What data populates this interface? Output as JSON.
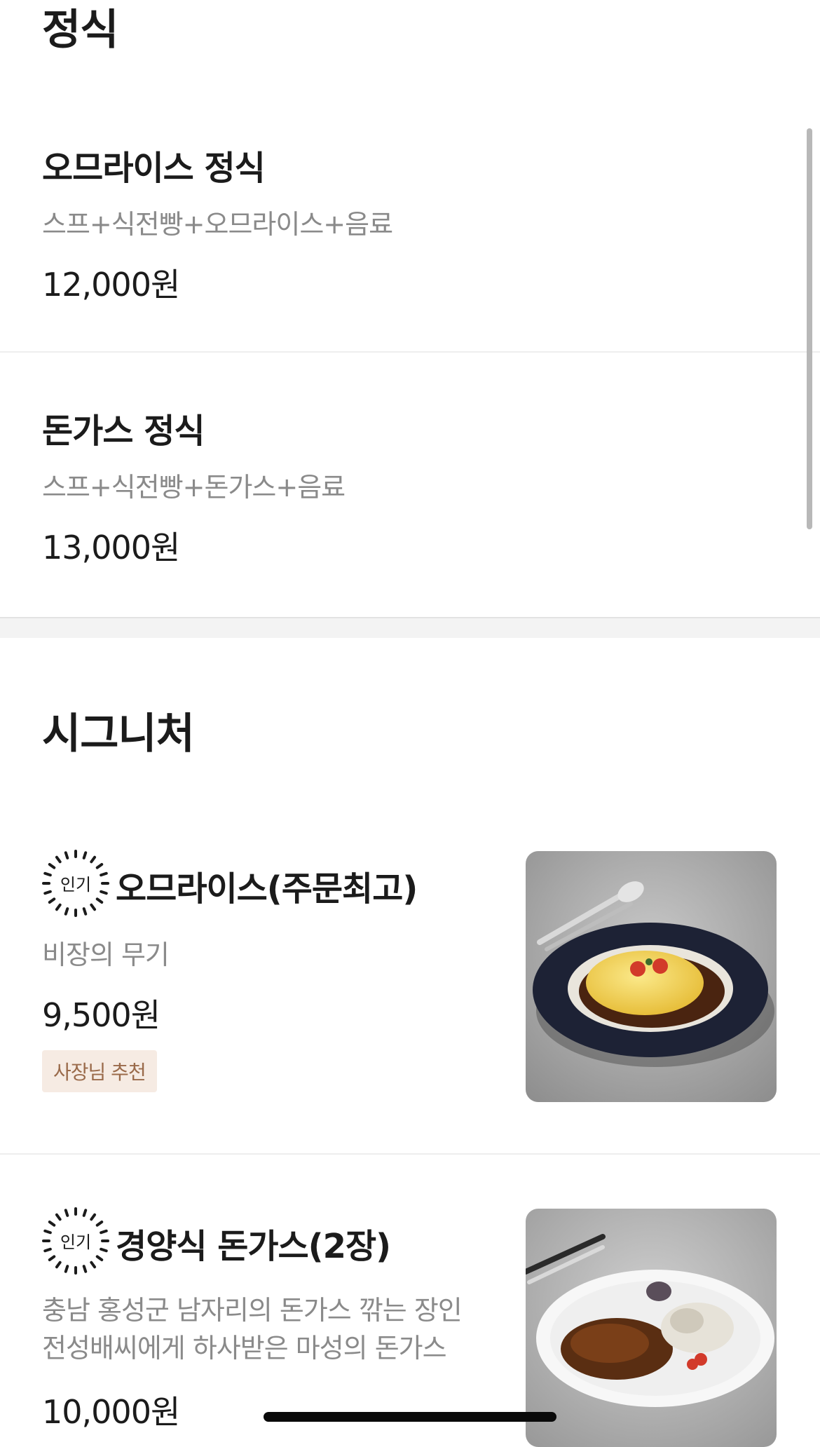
{
  "sections": [
    {
      "title": "정식",
      "items": [
        {
          "name": "오므라이스 정식",
          "desc": "스프+식전빵+오므라이스+음료",
          "price": "12,000원"
        },
        {
          "name": "돈가스 정식",
          "desc": "스프+식전빵+돈가스+음료",
          "price": "13,000원"
        }
      ]
    },
    {
      "title": "시그니처",
      "items": [
        {
          "badge": "인기",
          "name": "오므라이스(주문최고)",
          "desc": "비장의 무기",
          "price": "9,500원",
          "tag": "사장님 추천",
          "photo_icon": "omurice-photo"
        },
        {
          "badge": "인기",
          "name": "경양식 돈가스(2장)",
          "desc_lines": [
            "충남 홍성군 남자리의 돈가스 깎는 장인",
            "전성배씨에게 하사받은 마성의 돈가스"
          ],
          "price": "10,000원",
          "photo_icon": "tonkatsu-photo"
        }
      ]
    }
  ],
  "colors": {
    "text": "#1b1b1b",
    "desc": "#8a8a8a",
    "tag_bg": "#f6ebe3",
    "tag_text": "#9a6a4a"
  }
}
